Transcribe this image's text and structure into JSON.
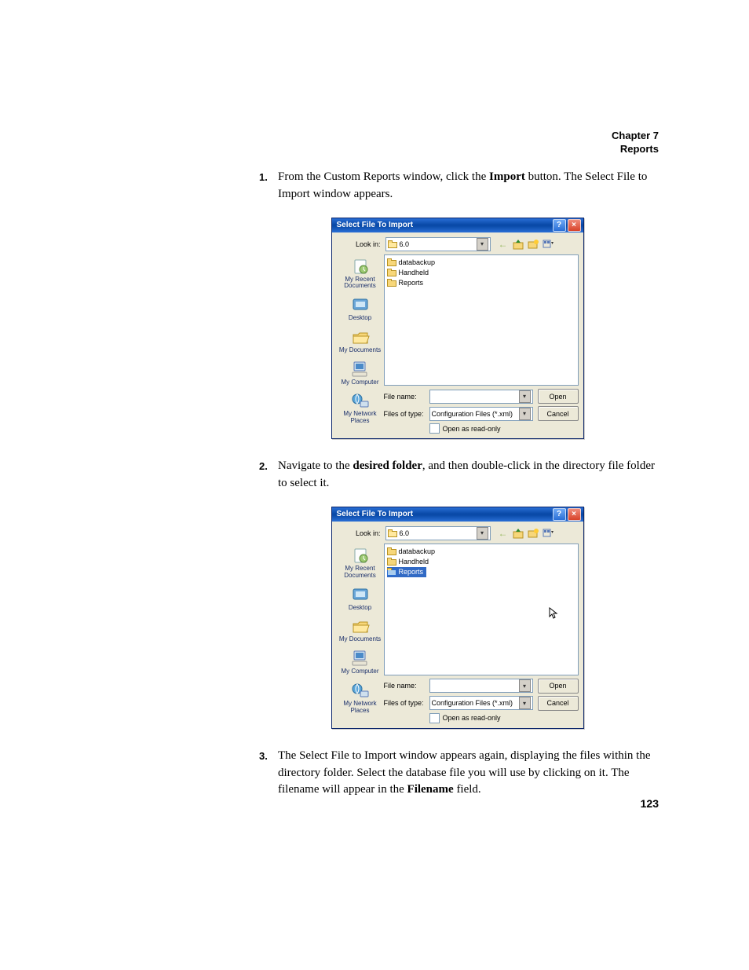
{
  "header": {
    "chapter": "Chapter 7",
    "section": "Reports"
  },
  "page_number": "123",
  "steps": {
    "s1": {
      "num": "1.",
      "pre": "From the Custom Reports window, click the ",
      "bold": "Import",
      "post": " button. The Select File to Import window appears."
    },
    "s2": {
      "num": "2.",
      "pre": "Navigate to the ",
      "bold": "desired folder",
      "post": ", and then double-click in the directory file folder to select it."
    },
    "s3": {
      "num": "3.",
      "pre": "The Select File to Import window appears again, displaying the files within the directory folder. Select the database file you will use by clicking on it. The filename will appear in the ",
      "bold": "Filename",
      "post": " field."
    }
  },
  "dialog": {
    "title": "Select File To Import",
    "lookin_label": "Look in:",
    "lookin_value": "6.0",
    "folders": [
      "databackup",
      "Handheld",
      "Reports"
    ],
    "places": {
      "recent": "My Recent Documents",
      "desktop": "Desktop",
      "mydocs": "My Documents",
      "mycomp": "My Computer",
      "mynet": "My Network Places"
    },
    "filename_label": "File name:",
    "filename_value": "",
    "filetype_label": "Files of type:",
    "filetype_value": "Configuration Files (*.xml)",
    "readonly_label": "Open as read-only",
    "open_btn": "Open",
    "cancel_btn": "Cancel"
  }
}
